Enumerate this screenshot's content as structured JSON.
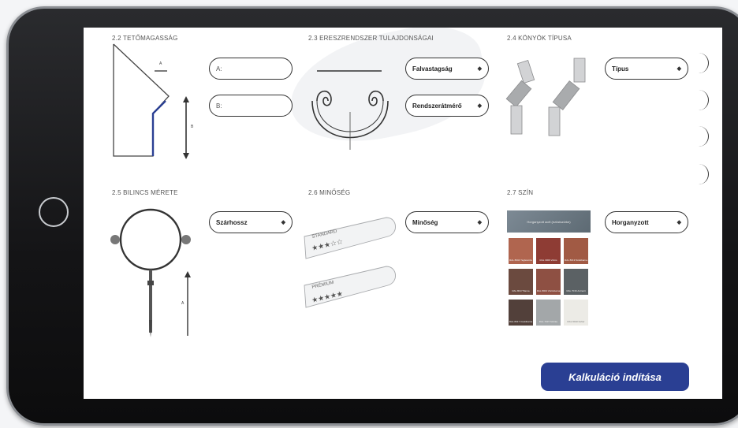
{
  "sections": {
    "roof_height": {
      "title": "2.2 TETŐMAGASSÁG",
      "diagram_label_a": "A",
      "diagram_label_b": "B",
      "input_a_placeholder": "A:",
      "input_b_placeholder": "B:"
    },
    "gutter_system": {
      "title": "2.3 ERESZRENDSZER TULAJDONSÁGAI",
      "select_wall_thickness": "Falvastagság",
      "select_gutter_size": "Rendszerátmérő"
    },
    "elbow_type": {
      "title": "2.4 KÖNYÖK TÍPUSA",
      "select_type": "Típus"
    },
    "clamp_size": {
      "title": "2.5 BILINCS MÉRETE",
      "diagram_label_a": "A",
      "select_shank_length": "Szárhossz"
    },
    "quality": {
      "title": "2.6 MINŐSÉG",
      "standard_label": "STANDARD",
      "premium_label": "PRÉMIUM",
      "standard_stars": "★★★☆☆",
      "premium_stars": "★★★★★",
      "select_quality": "Minőség"
    },
    "color": {
      "title": "2.7 SZÍN",
      "swatch_header": "Horganyzott acél (ezüstszürke)",
      "swatches": [
        {
          "label": "RAL 8004 Téglavörös",
          "color": "#b0654f"
        },
        {
          "label": "RAL 3009 Vörös",
          "color": "#8e3c34"
        },
        {
          "label": "RAL 8019 Sötétbarna",
          "color": "#a15a44"
        },
        {
          "label": "RAL 8017 Barna",
          "color": "#6b4a3f"
        },
        {
          "label": "RAL 8004 Vörösbarna",
          "color": "#8e5043"
        },
        {
          "label": "RAL 7016 Antracit",
          "color": "#5b6164"
        },
        {
          "label": "RAL 8017 Csokibarna",
          "color": "#52403a"
        },
        {
          "label": "RAL 7037 Szürke",
          "color": "#a3a7a9"
        },
        {
          "label": "RAL 9010 Fehér",
          "color": "#ecebe6"
        }
      ],
      "select_color": "Horganyzott"
    }
  },
  "actions": {
    "calculate_label": "Kalkuláció indítása"
  },
  "colors": {
    "accent": "#2a3f93",
    "diagram_blue": "#2a3f93"
  }
}
